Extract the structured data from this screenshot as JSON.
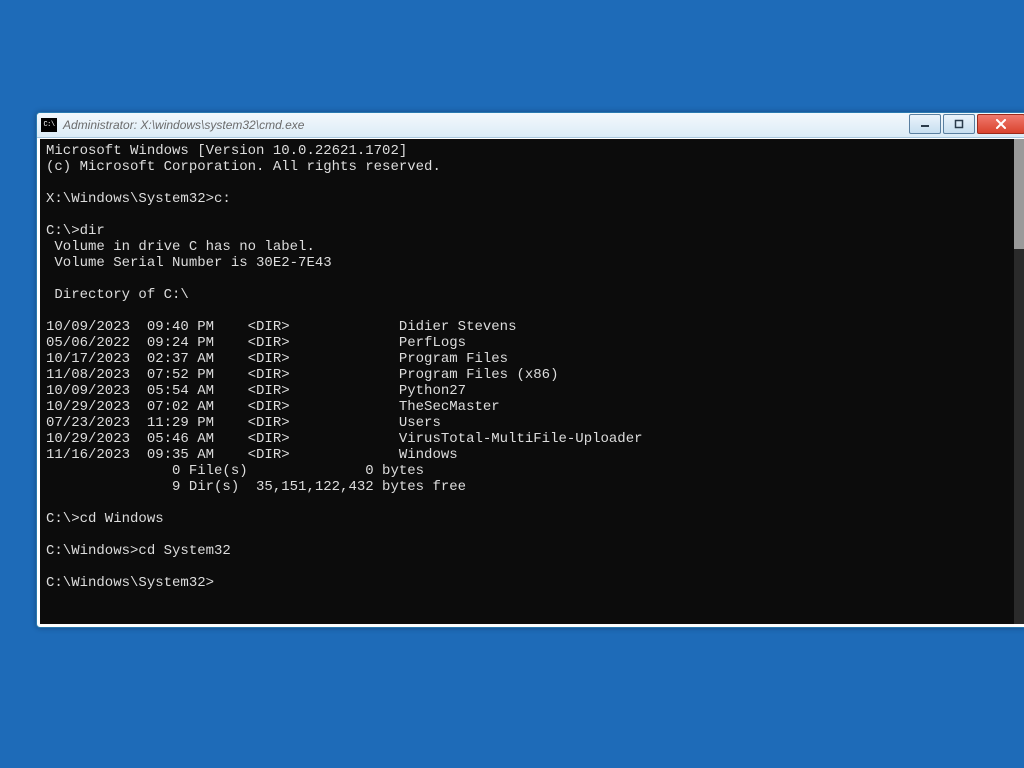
{
  "titlebar": {
    "title": "Administrator: X:\\windows\\system32\\cmd.exe"
  },
  "terminal": {
    "banner1": "Microsoft Windows [Version 10.0.22621.1702]",
    "banner2": "(c) Microsoft Corporation. All rights reserved.",
    "prompt1": "X:\\Windows\\System32>",
    "cmd1": "c:",
    "prompt2": "C:\\>",
    "cmd2": "dir",
    "vol1": " Volume in drive C has no label.",
    "vol2": " Volume Serial Number is 30E2-7E43",
    "dirof": " Directory of C:\\",
    "rows": [
      {
        "date": "10/09/2023",
        "time": "09:40 PM",
        "type": "<DIR>",
        "name": "Didier Stevens"
      },
      {
        "date": "05/06/2022",
        "time": "09:24 PM",
        "type": "<DIR>",
        "name": "PerfLogs"
      },
      {
        "date": "10/17/2023",
        "time": "02:37 AM",
        "type": "<DIR>",
        "name": "Program Files"
      },
      {
        "date": "11/08/2023",
        "time": "07:52 PM",
        "type": "<DIR>",
        "name": "Program Files (x86)"
      },
      {
        "date": "10/09/2023",
        "time": "05:54 AM",
        "type": "<DIR>",
        "name": "Python27"
      },
      {
        "date": "10/29/2023",
        "time": "07:02 AM",
        "type": "<DIR>",
        "name": "TheSecMaster"
      },
      {
        "date": "07/23/2023",
        "time": "11:29 PM",
        "type": "<DIR>",
        "name": "Users"
      },
      {
        "date": "10/29/2023",
        "time": "05:46 AM",
        "type": "<DIR>",
        "name": "VirusTotal-MultiFile-Uploader"
      },
      {
        "date": "11/16/2023",
        "time": "09:35 AM",
        "type": "<DIR>",
        "name": "Windows"
      }
    ],
    "summary1": "               0 File(s)              0 bytes",
    "summary2": "               9 Dir(s)  35,151,122,432 bytes free",
    "prompt3": "C:\\>",
    "cmd3": "cd Windows",
    "prompt4": "C:\\Windows>",
    "cmd4": "cd System32",
    "prompt5": "C:\\Windows\\System32>"
  }
}
